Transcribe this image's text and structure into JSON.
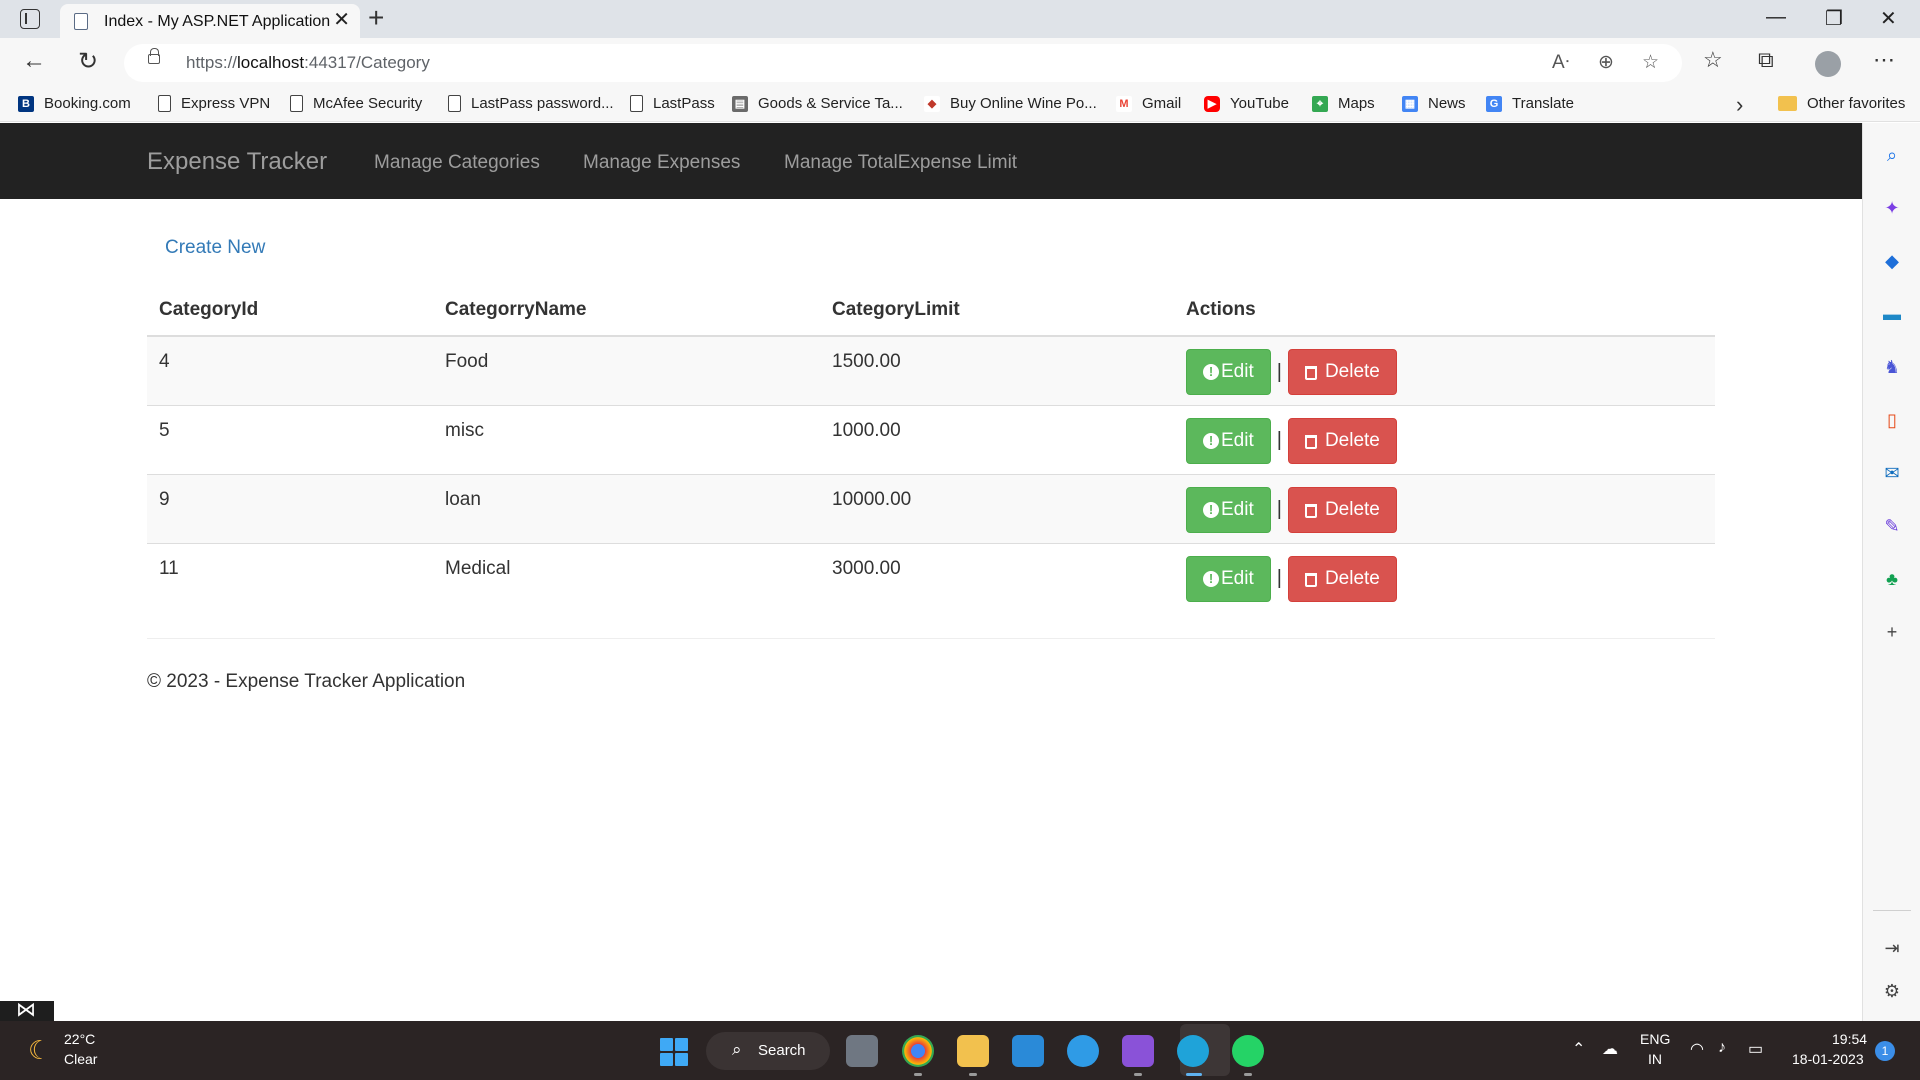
{
  "browser": {
    "tab_title": "Index - My ASP.NET Application",
    "tab_close": "✕",
    "new_tab": "+",
    "url_prefix": "https://",
    "url_host": "localhost",
    "url_rest": ":44317/Category",
    "favorites": [
      {
        "label": "Booking.com",
        "icon": "booking-icon",
        "color": "#003580"
      },
      {
        "label": "Express VPN",
        "icon": "page-icon"
      },
      {
        "label": "McAfee Security",
        "icon": "page-icon"
      },
      {
        "label": "LastPass password...",
        "icon": "page-icon"
      },
      {
        "label": "LastPass",
        "icon": "page-icon"
      },
      {
        "label": "Goods & Service Ta...",
        "icon": "gst-icon",
        "color": "#6a6a6a"
      },
      {
        "label": "Buy Online Wine Po...",
        "icon": "wine-icon",
        "color": "#c0392b"
      },
      {
        "label": "Gmail",
        "icon": "gmail-icon",
        "color": "#ea4335"
      },
      {
        "label": "YouTube",
        "icon": "youtube-icon",
        "color": "#ff0000"
      },
      {
        "label": "Maps",
        "icon": "maps-icon",
        "color": "#34a853"
      },
      {
        "label": "News",
        "icon": "news-icon",
        "color": "#4285f4"
      },
      {
        "label": "Translate",
        "icon": "translate-icon",
        "color": "#4285f4"
      }
    ],
    "other_favorites": "Other favorites"
  },
  "site": {
    "brand": "Expense Tracker",
    "nav": [
      "Manage Categories",
      "Manage Expenses",
      "Manage TotalExpense Limit"
    ],
    "create_new": "Create New",
    "columns": [
      "CategoryId",
      "CategorryName",
      "CategoryLimit",
      "Actions"
    ],
    "rows": [
      {
        "id": "4",
        "name": "Food",
        "limit": "1500.00"
      },
      {
        "id": "5",
        "name": "misc",
        "limit": "1000.00"
      },
      {
        "id": "9",
        "name": "loan",
        "limit": "10000.00"
      },
      {
        "id": "11",
        "name": "Medical",
        "limit": "3000.00"
      }
    ],
    "edit_label": "Edit",
    "delete_label": "Delete",
    "separator": "|",
    "footer": "© 2023 - Expense Tracker Application"
  },
  "taskbar": {
    "temperature": "22°C",
    "condition": "Clear",
    "search": "Search",
    "lang_top": "ENG",
    "lang_bottom": "IN",
    "time": "19:54",
    "date": "18-01-2023",
    "notifications": "1"
  },
  "colors": {
    "navbar": "#222222",
    "link": "#337ab7",
    "edit": "#5cb85c",
    "delete": "#d9534f"
  }
}
